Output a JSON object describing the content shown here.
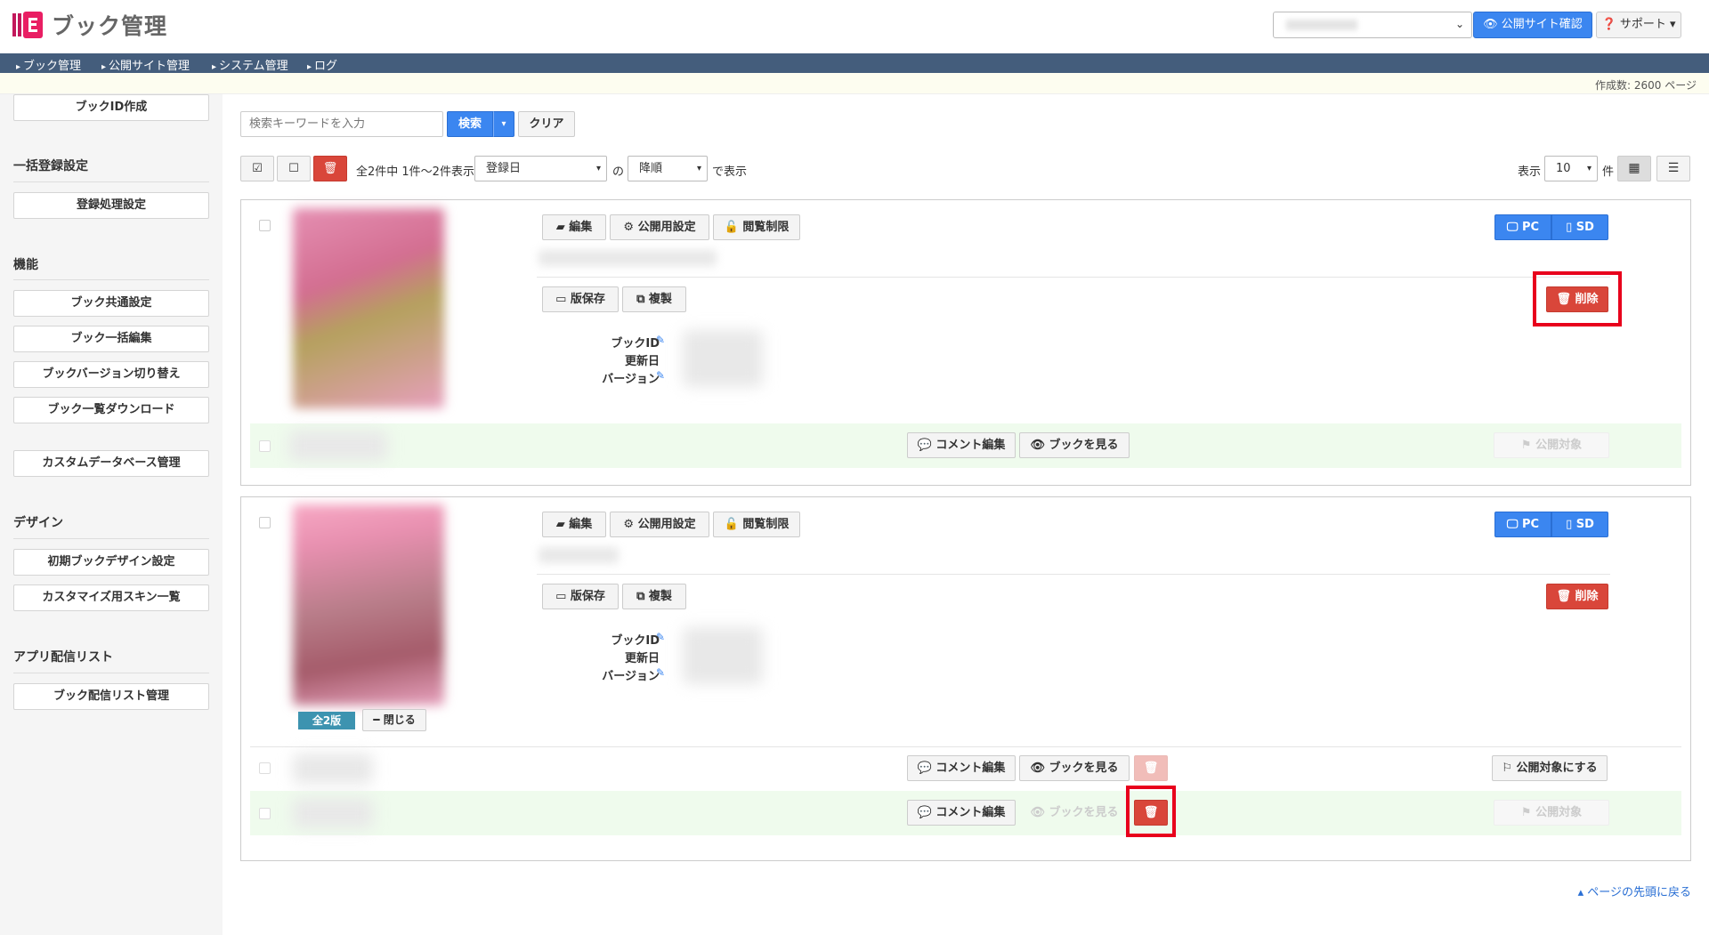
{
  "header": {
    "app_title": "ブック管理",
    "public_site_button": "👁 公開サイト確認",
    "support_button": "❓ サポート ▾"
  },
  "nav": {
    "items": [
      "ブック管理",
      "公開サイト管理",
      "システム管理",
      "ログ"
    ]
  },
  "infobar": {
    "page_count": "作成数: 2600 ページ"
  },
  "sidebar": {
    "create_button": "ブックID作成",
    "sections": [
      {
        "title": "一括登録設定",
        "items": [
          "登録処理設定"
        ]
      },
      {
        "title": "機能",
        "items": [
          "ブック共通設定",
          "ブック一括編集",
          "ブックバージョン切り替え",
          "ブック一覧ダウンロード",
          "カスタムデータベース管理"
        ]
      },
      {
        "title": "デザイン",
        "items": [
          "初期ブックデザイン設定",
          "カスタマイズ用スキン一覧"
        ]
      },
      {
        "title": "アプリ配信リスト",
        "items": [
          "ブック配信リスト管理"
        ]
      }
    ]
  },
  "search": {
    "placeholder": "検索キーワードを入力",
    "search_button": "検索",
    "clear_button": "クリア"
  },
  "list_toolbar": {
    "summary": "全2件中 1件～2件表示",
    "sort_field": "登録日",
    "of_text": "の",
    "sort_order": "降順",
    "display_text": "で表示",
    "show_label": "表示",
    "per_page": "10",
    "count_unit": "件"
  },
  "book_actions": {
    "edit": "編集",
    "publish_settings": "公開用設定",
    "access_control": "閲覧制限",
    "pc": "PC",
    "sd": "SD",
    "save_version": "版保存",
    "duplicate": "複製",
    "delete": "削除",
    "book_id_label": "ブックID",
    "updated_label": "更新日",
    "version_label": "バージョン",
    "comment_edit": "コメント編集",
    "view_book": "ブックを見る",
    "public_target": "公開対象",
    "make_public_target": "公開対象にする"
  },
  "book2": {
    "versions_badge": "全2版",
    "close_button": "閉じる"
  },
  "footer": {
    "back_to_top": "ページの先頭に戻る"
  },
  "colors": {
    "accent_blue": "#3b86f0",
    "delete_red": "#d9463a",
    "nav_bar": "#445d7c",
    "highlight": "#e8001c"
  }
}
